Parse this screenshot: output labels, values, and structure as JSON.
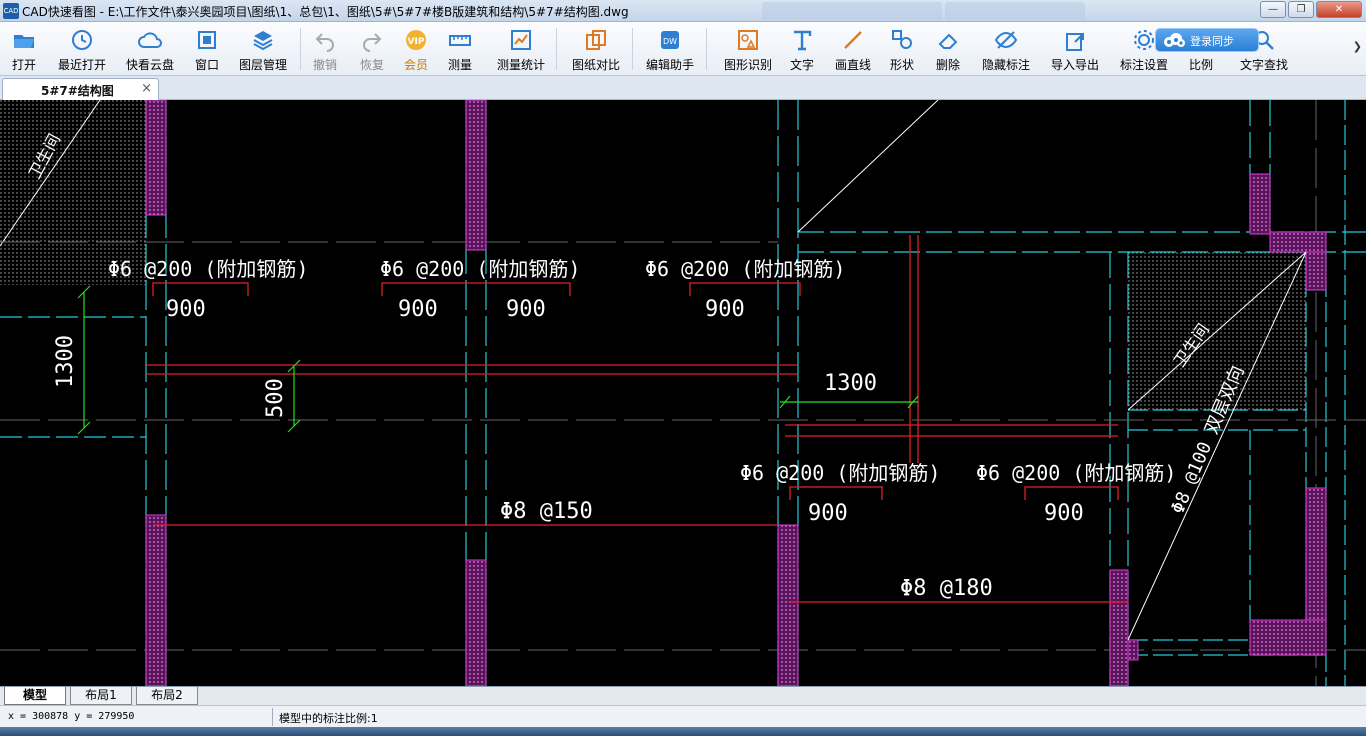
{
  "window": {
    "title": "CAD快速看图 - E:\\工作文件\\泰兴奥园项目\\图纸\\1、总包\\1、图纸\\5#\\5#7#楼B版建筑和结构\\5#7#结构图.dwg",
    "icon_label": "CAD"
  },
  "toolbar": {
    "items": [
      {
        "label": "打开",
        "icon": "folder-open-icon"
      },
      {
        "label": "最近打开",
        "icon": "clock-icon"
      },
      {
        "label": "快看云盘",
        "icon": "cloud-icon"
      },
      {
        "label": "窗口",
        "icon": "window-icon"
      },
      {
        "label": "图层管理",
        "icon": "layers-icon"
      },
      {
        "label": "撤销",
        "icon": "undo-icon",
        "disabled": true
      },
      {
        "label": "恢复",
        "icon": "redo-icon",
        "disabled": true
      },
      {
        "label": "会员",
        "icon": "vip-icon",
        "vip": true
      },
      {
        "label": "测量",
        "icon": "ruler-icon"
      },
      {
        "label": "测量统计",
        "icon": "measure-stats-icon"
      },
      {
        "label": "图纸对比",
        "icon": "compare-icon"
      },
      {
        "label": "编辑助手",
        "icon": "edit-assistant-icon"
      },
      {
        "label": "图形识别",
        "icon": "shape-recognize-icon"
      },
      {
        "label": "文字",
        "icon": "text-icon"
      },
      {
        "label": "画直线",
        "icon": "line-icon"
      },
      {
        "label": "形状",
        "icon": "shape-icon"
      },
      {
        "label": "删除",
        "icon": "eraser-icon"
      },
      {
        "label": "隐藏标注",
        "icon": "eye-hide-icon"
      },
      {
        "label": "导入导出",
        "icon": "import-export-icon"
      },
      {
        "label": "标注设置",
        "icon": "annotation-settings-icon"
      },
      {
        "label": "比例",
        "icon": "scale-icon"
      },
      {
        "label": "文字查找",
        "icon": "text-search-icon"
      }
    ],
    "cloud_badge": "登录同步"
  },
  "document_tab": {
    "label": "5#7#结构图",
    "close": "×"
  },
  "drawing": {
    "room_label_1": "卫生间",
    "room_label_2": "卫生间",
    "rebar_labels": [
      "Φ6 @200 (附加钢筋)",
      "Φ6 @200 (附加钢筋)",
      "Φ6 @200 (附加钢筋)",
      "Φ6 @200 (附加钢筋)",
      "Φ6 @200 (附加钢筋)"
    ],
    "rebar_main_1": "Φ8 @150",
    "rebar_main_2": "Φ8 @180",
    "rebar_diag": "Φ8 @100 双层双向",
    "dims": {
      "d900_1": "900",
      "d900_2": "900",
      "d900_3": "900",
      "d900_4": "900",
      "d900_5": "900",
      "d900_6": "900",
      "d1300_v": "1300",
      "d500_v": "500",
      "d1300_h": "1300"
    }
  },
  "layout_tabs": [
    {
      "label": "模型",
      "active": true
    },
    {
      "label": "布局1",
      "active": false
    },
    {
      "label": "布局2",
      "active": false
    }
  ],
  "status": {
    "coords": "x = 300878  y = 279950",
    "scale_note": "模型中的标注比例:1"
  },
  "colors": {
    "canvas_bg": "#000000",
    "wall_magenta": "#d33ad3",
    "axis_cyan": "#25c8d6",
    "rebar_red": "#e0202a",
    "dim_green": "#22e022",
    "text_white": "#ffffff"
  }
}
